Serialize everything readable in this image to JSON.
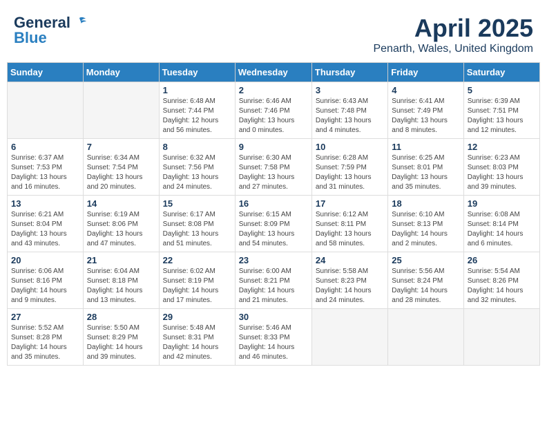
{
  "header": {
    "logo_line1": "General",
    "logo_line2": "Blue",
    "month": "April 2025",
    "location": "Penarth, Wales, United Kingdom"
  },
  "weekdays": [
    "Sunday",
    "Monday",
    "Tuesday",
    "Wednesday",
    "Thursday",
    "Friday",
    "Saturday"
  ],
  "weeks": [
    [
      {
        "day": "",
        "info": ""
      },
      {
        "day": "",
        "info": ""
      },
      {
        "day": "1",
        "info": "Sunrise: 6:48 AM\nSunset: 7:44 PM\nDaylight: 12 hours\nand 56 minutes."
      },
      {
        "day": "2",
        "info": "Sunrise: 6:46 AM\nSunset: 7:46 PM\nDaylight: 13 hours\nand 0 minutes."
      },
      {
        "day": "3",
        "info": "Sunrise: 6:43 AM\nSunset: 7:48 PM\nDaylight: 13 hours\nand 4 minutes."
      },
      {
        "day": "4",
        "info": "Sunrise: 6:41 AM\nSunset: 7:49 PM\nDaylight: 13 hours\nand 8 minutes."
      },
      {
        "day": "5",
        "info": "Sunrise: 6:39 AM\nSunset: 7:51 PM\nDaylight: 13 hours\nand 12 minutes."
      }
    ],
    [
      {
        "day": "6",
        "info": "Sunrise: 6:37 AM\nSunset: 7:53 PM\nDaylight: 13 hours\nand 16 minutes."
      },
      {
        "day": "7",
        "info": "Sunrise: 6:34 AM\nSunset: 7:54 PM\nDaylight: 13 hours\nand 20 minutes."
      },
      {
        "day": "8",
        "info": "Sunrise: 6:32 AM\nSunset: 7:56 PM\nDaylight: 13 hours\nand 24 minutes."
      },
      {
        "day": "9",
        "info": "Sunrise: 6:30 AM\nSunset: 7:58 PM\nDaylight: 13 hours\nand 27 minutes."
      },
      {
        "day": "10",
        "info": "Sunrise: 6:28 AM\nSunset: 7:59 PM\nDaylight: 13 hours\nand 31 minutes."
      },
      {
        "day": "11",
        "info": "Sunrise: 6:25 AM\nSunset: 8:01 PM\nDaylight: 13 hours\nand 35 minutes."
      },
      {
        "day": "12",
        "info": "Sunrise: 6:23 AM\nSunset: 8:03 PM\nDaylight: 13 hours\nand 39 minutes."
      }
    ],
    [
      {
        "day": "13",
        "info": "Sunrise: 6:21 AM\nSunset: 8:04 PM\nDaylight: 13 hours\nand 43 minutes."
      },
      {
        "day": "14",
        "info": "Sunrise: 6:19 AM\nSunset: 8:06 PM\nDaylight: 13 hours\nand 47 minutes."
      },
      {
        "day": "15",
        "info": "Sunrise: 6:17 AM\nSunset: 8:08 PM\nDaylight: 13 hours\nand 51 minutes."
      },
      {
        "day": "16",
        "info": "Sunrise: 6:15 AM\nSunset: 8:09 PM\nDaylight: 13 hours\nand 54 minutes."
      },
      {
        "day": "17",
        "info": "Sunrise: 6:12 AM\nSunset: 8:11 PM\nDaylight: 13 hours\nand 58 minutes."
      },
      {
        "day": "18",
        "info": "Sunrise: 6:10 AM\nSunset: 8:13 PM\nDaylight: 14 hours\nand 2 minutes."
      },
      {
        "day": "19",
        "info": "Sunrise: 6:08 AM\nSunset: 8:14 PM\nDaylight: 14 hours\nand 6 minutes."
      }
    ],
    [
      {
        "day": "20",
        "info": "Sunrise: 6:06 AM\nSunset: 8:16 PM\nDaylight: 14 hours\nand 9 minutes."
      },
      {
        "day": "21",
        "info": "Sunrise: 6:04 AM\nSunset: 8:18 PM\nDaylight: 14 hours\nand 13 minutes."
      },
      {
        "day": "22",
        "info": "Sunrise: 6:02 AM\nSunset: 8:19 PM\nDaylight: 14 hours\nand 17 minutes."
      },
      {
        "day": "23",
        "info": "Sunrise: 6:00 AM\nSunset: 8:21 PM\nDaylight: 14 hours\nand 21 minutes."
      },
      {
        "day": "24",
        "info": "Sunrise: 5:58 AM\nSunset: 8:23 PM\nDaylight: 14 hours\nand 24 minutes."
      },
      {
        "day": "25",
        "info": "Sunrise: 5:56 AM\nSunset: 8:24 PM\nDaylight: 14 hours\nand 28 minutes."
      },
      {
        "day": "26",
        "info": "Sunrise: 5:54 AM\nSunset: 8:26 PM\nDaylight: 14 hours\nand 32 minutes."
      }
    ],
    [
      {
        "day": "27",
        "info": "Sunrise: 5:52 AM\nSunset: 8:28 PM\nDaylight: 14 hours\nand 35 minutes."
      },
      {
        "day": "28",
        "info": "Sunrise: 5:50 AM\nSunset: 8:29 PM\nDaylight: 14 hours\nand 39 minutes."
      },
      {
        "day": "29",
        "info": "Sunrise: 5:48 AM\nSunset: 8:31 PM\nDaylight: 14 hours\nand 42 minutes."
      },
      {
        "day": "30",
        "info": "Sunrise: 5:46 AM\nSunset: 8:33 PM\nDaylight: 14 hours\nand 46 minutes."
      },
      {
        "day": "",
        "info": ""
      },
      {
        "day": "",
        "info": ""
      },
      {
        "day": "",
        "info": ""
      }
    ]
  ]
}
